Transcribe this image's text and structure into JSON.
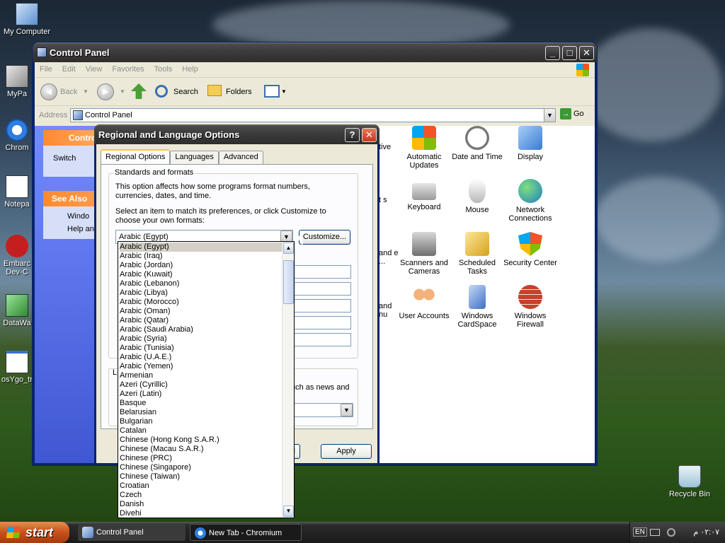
{
  "desktop": {
    "icons": [
      {
        "label": "My Computer"
      },
      {
        "label": "MyPa"
      },
      {
        "label": "Chrom"
      },
      {
        "label": "Notepa"
      },
      {
        "label": "Embarc Dev-C"
      },
      {
        "label": "DataWa"
      },
      {
        "label": "osYgo_tr"
      },
      {
        "label": "Recycle Bin"
      }
    ]
  },
  "control_panel": {
    "title": "Control Panel",
    "menu": [
      "File",
      "Edit",
      "View",
      "Favorites",
      "Tools",
      "Help"
    ],
    "toolbar": {
      "back": "Back",
      "search": "Search",
      "folders": "Folders"
    },
    "address_label": "Address",
    "address_value": "Control Panel",
    "go_label": "Go",
    "left_pane": {
      "control_head": "Contro",
      "switch_link": "Switch",
      "see_also": "See Also",
      "see_also_items": [
        "Windo",
        "Help an"
      ]
    },
    "items": [
      {
        "label": "tive"
      },
      {
        "label": "Automatic Updates"
      },
      {
        "label": "Date and Time"
      },
      {
        "label": "Display"
      },
      {
        "label": "t s"
      },
      {
        "label": "Keyboard"
      },
      {
        "label": "Mouse"
      },
      {
        "label": "Network Connections"
      },
      {
        "label": "and e ..."
      },
      {
        "label": "Scanners and Cameras"
      },
      {
        "label": "Scheduled Tasks"
      },
      {
        "label": "Security Center"
      },
      {
        "label": "and nu"
      },
      {
        "label": "User Accounts"
      },
      {
        "label": "Windows CardSpace"
      },
      {
        "label": "Windows Firewall"
      }
    ]
  },
  "dialog": {
    "title": "Regional and Language Options",
    "help_btn": "?",
    "close_btn": "✕",
    "tabs": [
      "Regional Options",
      "Languages",
      "Advanced"
    ],
    "group_title": "Standards and formats",
    "desc1": "This option affects how some programs format numbers, currencies, dates, and time.",
    "desc2": "Select an item to match its preferences, or click Customize to choose your own formats:",
    "selected_format": "Arabic (Egypt)",
    "customize_btn": "Customize...",
    "partial_text": "uch as news and",
    "partial_l": "L",
    "cancel_partial": "el",
    "apply_btn": "Apply"
  },
  "format_list": [
    "Arabic (Egypt)",
    "Arabic (Iraq)",
    "Arabic (Jordan)",
    "Arabic (Kuwait)",
    "Arabic (Lebanon)",
    "Arabic (Libya)",
    "Arabic (Morocco)",
    "Arabic (Oman)",
    "Arabic (Qatar)",
    "Arabic (Saudi Arabia)",
    "Arabic (Syria)",
    "Arabic (Tunisia)",
    "Arabic (U.A.E.)",
    "Arabic (Yemen)",
    "Armenian",
    "Azeri (Cyrillic)",
    "Azeri (Latin)",
    "Basque",
    "Belarusian",
    "Bulgarian",
    "Catalan",
    "Chinese (Hong Kong S.A.R.)",
    "Chinese (Macau S.A.R.)",
    "Chinese (PRC)",
    "Chinese (Singapore)",
    "Chinese (Taiwan)",
    "Croatian",
    "Czech",
    "Danish",
    "Divehi"
  ],
  "taskbar": {
    "start": "start",
    "tasks": [
      "Control Panel",
      "New Tab - Chromium"
    ],
    "lang": "EN",
    "clock": "٠٢:٠٧ م"
  }
}
